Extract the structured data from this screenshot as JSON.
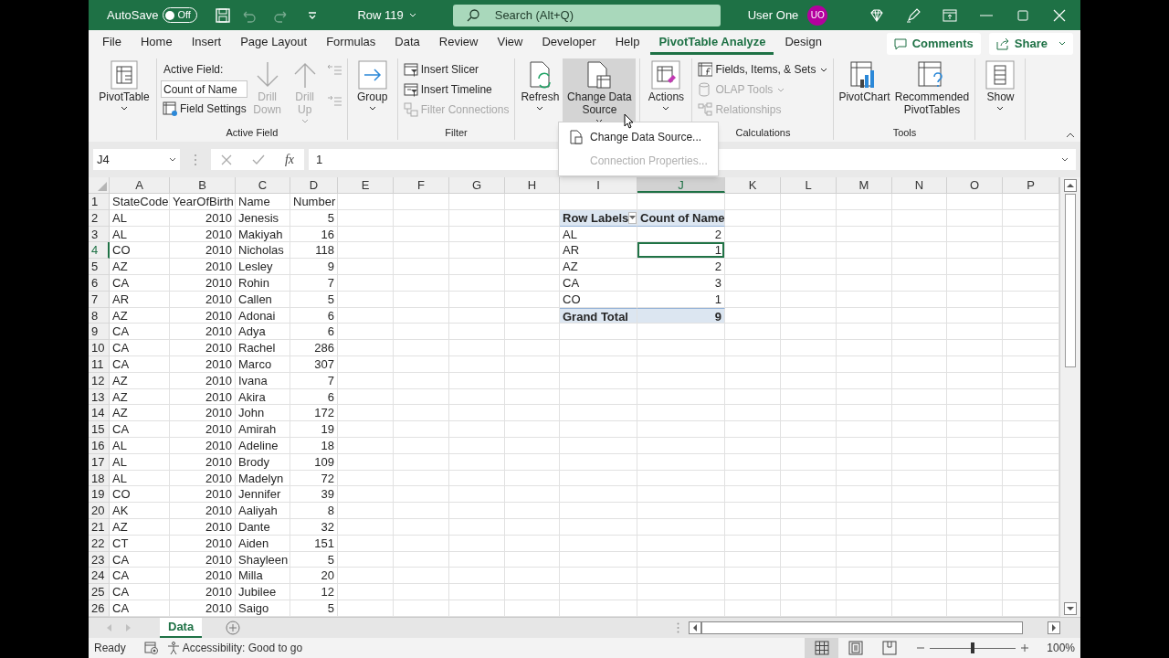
{
  "title_bar": {
    "autosave": {
      "label": "AutoSave",
      "on": false,
      "state_text": "Off"
    },
    "quick_access": [
      {
        "disabled": false
      },
      {
        "disabled": true
      },
      {
        "disabled": true
      },
      {
        "disabled": false
      }
    ],
    "document_title": "Row 119",
    "search": {
      "placeholder": "Search (Alt+Q)"
    },
    "user_name": "User One",
    "avatar_initials": "UO"
  },
  "menu_tabs": [
    {
      "label": "File",
      "selected": false
    },
    {
      "label": "Home",
      "selected": false
    },
    {
      "label": "Insert",
      "selected": false
    },
    {
      "label": "Page Layout",
      "selected": false
    },
    {
      "label": "Formulas",
      "selected": false
    },
    {
      "label": "Data",
      "selected": false
    },
    {
      "label": "Review",
      "selected": false
    },
    {
      "label": "View",
      "selected": false
    },
    {
      "label": "Developer",
      "selected": false
    },
    {
      "label": "Help",
      "selected": false
    },
    {
      "label": "PivotTable Analyze",
      "selected": true
    },
    {
      "label": "Design",
      "selected": false
    }
  ],
  "comments_button": "Comments",
  "share_button": "Share",
  "ribbon_groups": [
    {
      "columns": [
        {
          "kind": "large",
          "label": "PivotTable",
          "caret": true,
          "disabled": false,
          "pressed": false
        }
      ]
    },
    {
      "label": "Active Field",
      "columns": [
        {
          "kind": "stack",
          "items": [
            {
              "kind": "caption",
              "label": "Active Field:"
            },
            {
              "kind": "field",
              "value": "Count of Name"
            },
            {
              "kind": "small",
              "label": "Field Settings",
              "caret": false,
              "disabled": false
            }
          ]
        },
        {
          "kind": "large",
          "label": "Drill Down",
          "caret": false,
          "disabled": true,
          "pressed": false
        },
        {
          "kind": "large",
          "label": "Drill Up",
          "caret": true,
          "disabled": true,
          "pressed": false
        },
        {
          "kind": "stack",
          "items": [
            {
              "kind": "icon",
              "disabled": true
            },
            {
              "kind": "icon",
              "disabled": true
            }
          ]
        }
      ]
    },
    {
      "columns": [
        {
          "kind": "large",
          "label": "Group",
          "caret": true,
          "disabled": false,
          "pressed": false
        }
      ]
    },
    {
      "label": "Filter",
      "columns": [
        {
          "kind": "stack",
          "items": [
            {
              "kind": "small",
              "label": "Insert Slicer",
              "caret": false,
              "disabled": false
            },
            {
              "kind": "small",
              "label": "Insert Timeline",
              "caret": false,
              "disabled": false
            },
            {
              "kind": "small",
              "label": "Filter Connections",
              "caret": false,
              "disabled": true
            }
          ]
        }
      ]
    },
    {
      "columns": [
        {
          "kind": "large",
          "label": "Refresh",
          "caret": true,
          "disabled": false,
          "pressed": false
        },
        {
          "kind": "large",
          "label": "Change Data Source",
          "caret": true,
          "disabled": false,
          "pressed": true
        }
      ]
    },
    {
      "columns": [
        {
          "kind": "large",
          "label": "Actions",
          "caret": true,
          "disabled": false,
          "pressed": false
        }
      ]
    },
    {
      "label": "Calculations",
      "columns": [
        {
          "kind": "stack",
          "items": [
            {
              "kind": "small",
              "label": "Fields, Items, & Sets",
              "caret": true,
              "disabled": false
            },
            {
              "kind": "small",
              "label": "OLAP Tools",
              "caret": true,
              "disabled": true
            },
            {
              "kind": "small",
              "label": "Relationships",
              "caret": false,
              "disabled": true
            }
          ]
        }
      ]
    },
    {
      "label": "Tools",
      "columns": [
        {
          "kind": "large",
          "label": "PivotChart",
          "caret": false,
          "disabled": false,
          "pressed": false
        },
        {
          "kind": "large",
          "label": "Recommended PivotTables",
          "caret": false,
          "disabled": false,
          "pressed": false
        }
      ]
    },
    {
      "columns": [
        {
          "kind": "large",
          "label": "Show",
          "caret": true,
          "disabled": false,
          "pressed": false
        }
      ]
    }
  ],
  "dropdown_menu": [
    {
      "label": "Change Data Source...",
      "disabled": false
    },
    {
      "label": "Connection Properties...",
      "disabled": true
    }
  ],
  "formula_bar": {
    "name_box": "J4",
    "function_label": "fx",
    "formula": "1"
  },
  "columns": [
    {
      "label": "A",
      "selected": false
    },
    {
      "label": "B",
      "selected": false
    },
    {
      "label": "C",
      "selected": false
    },
    {
      "label": "D",
      "selected": false
    },
    {
      "label": "E",
      "selected": false
    },
    {
      "label": "F",
      "selected": false
    },
    {
      "label": "G",
      "selected": false
    },
    {
      "label": "H",
      "selected": false
    },
    {
      "label": "I",
      "selected": false
    },
    {
      "label": "J",
      "selected": true
    },
    {
      "label": "K",
      "selected": false
    },
    {
      "label": "L",
      "selected": false
    },
    {
      "label": "M",
      "selected": false
    },
    {
      "label": "N",
      "selected": false
    },
    {
      "label": "O",
      "selected": false
    },
    {
      "label": "P",
      "selected": false
    }
  ],
  "rows": [
    {
      "label": "1",
      "selected": false,
      "cells": [
        "StateCode",
        "YearOfBirth",
        "Name",
        "Number"
      ]
    },
    {
      "label": "2",
      "selected": false,
      "cells": [
        "AL",
        "2010",
        "Jenesis",
        "5"
      ]
    },
    {
      "label": "3",
      "selected": false,
      "cells": [
        "AL",
        "2010",
        "Makiyah",
        "16"
      ]
    },
    {
      "label": "4",
      "selected": true,
      "cells": [
        "CO",
        "2010",
        "Nicholas",
        "118"
      ]
    },
    {
      "label": "5",
      "selected": false,
      "cells": [
        "AZ",
        "2010",
        "Lesley",
        "9"
      ]
    },
    {
      "label": "6",
      "selected": false,
      "cells": [
        "CA",
        "2010",
        "Rohin",
        "7"
      ]
    },
    {
      "label": "7",
      "selected": false,
      "cells": [
        "AR",
        "2010",
        "Callen",
        "5"
      ]
    },
    {
      "label": "8",
      "selected": false,
      "cells": [
        "AZ",
        "2010",
        "Adonai",
        "6"
      ]
    },
    {
      "label": "9",
      "selected": false,
      "cells": [
        "CA",
        "2010",
        "Adya",
        "6"
      ]
    },
    {
      "label": "10",
      "selected": false,
      "cells": [
        "CA",
        "2010",
        "Rachel",
        "286"
      ]
    },
    {
      "label": "11",
      "selected": false,
      "cells": [
        "CA",
        "2010",
        "Marco",
        "307"
      ]
    },
    {
      "label": "12",
      "selected": false,
      "cells": [
        "AZ",
        "2010",
        "Ivana",
        "7"
      ]
    },
    {
      "label": "13",
      "selected": false,
      "cells": [
        "AZ",
        "2010",
        "Akira",
        "6"
      ]
    },
    {
      "label": "14",
      "selected": false,
      "cells": [
        "AZ",
        "2010",
        "John",
        "172"
      ]
    },
    {
      "label": "15",
      "selected": false,
      "cells": [
        "CA",
        "2010",
        "Amirah",
        "19"
      ]
    },
    {
      "label": "16",
      "selected": false,
      "cells": [
        "AL",
        "2010",
        "Adeline",
        "18"
      ]
    },
    {
      "label": "17",
      "selected": false,
      "cells": [
        "AL",
        "2010",
        "Brody",
        "109"
      ]
    },
    {
      "label": "18",
      "selected": false,
      "cells": [
        "AL",
        "2010",
        "Madelyn",
        "72"
      ]
    },
    {
      "label": "19",
      "selected": false,
      "cells": [
        "CO",
        "2010",
        "Jennifer",
        "39"
      ]
    },
    {
      "label": "20",
      "selected": false,
      "cells": [
        "AK",
        "2010",
        "Aaliyah",
        "8"
      ]
    },
    {
      "label": "21",
      "selected": false,
      "cells": [
        "AZ",
        "2010",
        "Dante",
        "32"
      ]
    },
    {
      "label": "22",
      "selected": false,
      "cells": [
        "CT",
        "2010",
        "Aiden",
        "151"
      ]
    },
    {
      "label": "23",
      "selected": false,
      "cells": [
        "CA",
        "2010",
        "Shayleen",
        "5"
      ]
    },
    {
      "label": "24",
      "selected": false,
      "cells": [
        "CA",
        "2010",
        "Milla",
        "20"
      ]
    },
    {
      "label": "25",
      "selected": false,
      "cells": [
        "CA",
        "2010",
        "Jubilee",
        "12"
      ]
    },
    {
      "label": "26",
      "selected": false,
      "cells": [
        "CA",
        "2010",
        "Saigo",
        "5"
      ]
    }
  ],
  "pivot_table": {
    "headers": [
      "Row Labels",
      "Count of Name"
    ],
    "rows": [
      {
        "label": "AL",
        "value": "2",
        "selected": false
      },
      {
        "label": "AR",
        "value": "1",
        "selected": true
      },
      {
        "label": "AZ",
        "value": "2",
        "selected": false
      },
      {
        "label": "CA",
        "value": "3",
        "selected": false
      },
      {
        "label": "CO",
        "value": "1",
        "selected": false
      }
    ],
    "total": {
      "label": "Grand Total",
      "value": "9"
    }
  },
  "sheet_tabs": [
    {
      "label": "Data",
      "selected": true
    }
  ],
  "status_bar": {
    "mode": "Ready",
    "accessibility": "Accessibility: Good to go",
    "views": [
      {
        "selected": true
      },
      {
        "selected": false
      },
      {
        "selected": false
      }
    ],
    "zoom_slider": {
      "level": 0.5
    },
    "zoom": "100%"
  }
}
